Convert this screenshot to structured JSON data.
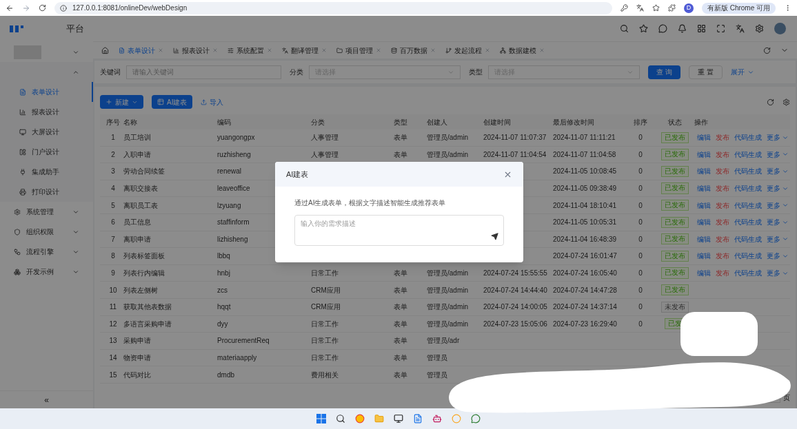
{
  "browser": {
    "url": "127.0.0.1:8081/onlineDev/webDesign",
    "profile": "D",
    "update_label": "有新版 Chrome 可用"
  },
  "header": {
    "title": "平台"
  },
  "tabs": [
    {
      "label": "表单设计",
      "selected": true
    },
    {
      "label": "报表设计",
      "selected": false
    },
    {
      "label": "系统配置",
      "selected": false
    },
    {
      "label": "翻译管理",
      "selected": false
    },
    {
      "label": "项目管理",
      "selected": false
    },
    {
      "label": "百万数据",
      "selected": false
    },
    {
      "label": "发起流程",
      "selected": false
    },
    {
      "label": "数据建模",
      "selected": false
    }
  ],
  "sidebar": {
    "menu": [
      {
        "expanded": true,
        "children": [
          {
            "label": "表单设计",
            "selected": true
          },
          {
            "label": "报表设计",
            "selected": false
          },
          {
            "label": "大屏设计",
            "selected": false
          },
          {
            "label": "门户设计",
            "selected": false
          },
          {
            "label": "集成助手",
            "selected": false
          },
          {
            "label": "打印设计",
            "selected": false
          }
        ]
      },
      {
        "label": "系统管理",
        "expanded": false
      },
      {
        "label": "组织权限",
        "expanded": false
      },
      {
        "label": "流程引擎",
        "expanded": false
      },
      {
        "label": "开发示例",
        "expanded": false
      }
    ],
    "collapse": "«"
  },
  "filters": [
    {
      "label": "关键词",
      "kind": "input",
      "placeholder": "请输入关键词"
    },
    {
      "label": "分类",
      "kind": "select",
      "placeholder": "请选择"
    },
    {
      "label": "类型",
      "kind": "select",
      "placeholder": "请选择"
    }
  ],
  "filter_buttons": {
    "query": "查 询",
    "reset": "重 置",
    "expand": "展开"
  },
  "toolbar": {
    "new": "新建",
    "ai": "AI建表",
    "import": "导入"
  },
  "table": {
    "columns": [
      "序号",
      "名称",
      "编码",
      "分类",
      "类型",
      "创建人",
      "创建时间",
      "最后修改时间",
      "排序",
      "状态",
      "操作"
    ],
    "rows": [
      {
        "index": "1",
        "name": "员工培训",
        "code": "yuangongpx",
        "category": "人事管理",
        "type": "表单",
        "creator": "管理员/admin",
        "created": "2024-11-07 11:07:37",
        "modified": "2024-11-07 11:11:21",
        "sort": "0",
        "status": {
          "label": "已发布",
          "published": true
        },
        "actions": [
          {
            "label": "编辑",
            "kind": "link"
          },
          {
            "label": "发布",
            "kind": "danger"
          },
          {
            "label": "代码生成",
            "kind": "link"
          },
          {
            "label": "更多",
            "kind": "dropdown"
          }
        ]
      },
      {
        "index": "2",
        "name": "入职申请",
        "code": "ruzhisheng",
        "category": "人事管理",
        "type": "表单",
        "creator": "管理员/admin",
        "created": "2024-11-07 11:04:54",
        "modified": "2024-11-07 11:04:58",
        "sort": "0",
        "status": {
          "label": "已发布",
          "published": true
        },
        "actions": [
          {
            "label": "编辑",
            "kind": "link"
          },
          {
            "label": "发布",
            "kind": "danger"
          },
          {
            "label": "代码生成",
            "kind": "link"
          },
          {
            "label": "更多",
            "kind": "dropdown"
          }
        ]
      },
      {
        "index": "3",
        "name": "劳动合同续签",
        "code": "renewal",
        "modified": "2024-11-05 10:08:45",
        "sort": "0",
        "status": {
          "label": "已发布",
          "published": true
        },
        "actions": [
          {
            "label": "编辑",
            "kind": "link"
          },
          {
            "label": "发布",
            "kind": "danger"
          },
          {
            "label": "代码生成",
            "kind": "link"
          },
          {
            "label": "更多",
            "kind": "dropdown"
          }
        ]
      },
      {
        "index": "4",
        "name": "离职交接表",
        "code": "leaveoffice",
        "modified": "2024-11-05 09:38:49",
        "sort": "0",
        "status": {
          "label": "已发布",
          "published": true
        },
        "actions": [
          {
            "label": "编辑",
            "kind": "link"
          },
          {
            "label": "发布",
            "kind": "danger"
          },
          {
            "label": "代码生成",
            "kind": "link"
          },
          {
            "label": "更多",
            "kind": "dropdown"
          }
        ]
      },
      {
        "index": "5",
        "name": "离职员工表",
        "code": "lzyuang",
        "modified": "2024-11-04 18:10:41",
        "sort": "0",
        "status": {
          "label": "已发布",
          "published": true
        },
        "actions": [
          {
            "label": "编辑",
            "kind": "link"
          },
          {
            "label": "发布",
            "kind": "danger"
          },
          {
            "label": "代码生成",
            "kind": "link"
          },
          {
            "label": "更多",
            "kind": "dropdown"
          }
        ]
      },
      {
        "index": "6",
        "name": "员工信息",
        "code": "staffinform",
        "modified": "2024-11-05 10:05:31",
        "sort": "0",
        "status": {
          "label": "已发布",
          "published": true
        },
        "actions": [
          {
            "label": "编辑",
            "kind": "link"
          },
          {
            "label": "发布",
            "kind": "danger"
          },
          {
            "label": "代码生成",
            "kind": "link"
          },
          {
            "label": "更多",
            "kind": "dropdown"
          }
        ]
      },
      {
        "index": "7",
        "name": "离职申请",
        "code": "lizhisheng",
        "modified": "2024-11-04 16:48:39",
        "sort": "0",
        "status": {
          "label": "已发布",
          "published": true
        },
        "actions": [
          {
            "label": "编辑",
            "kind": "link"
          },
          {
            "label": "发布",
            "kind": "danger"
          },
          {
            "label": "代码生成",
            "kind": "link"
          },
          {
            "label": "更多",
            "kind": "dropdown"
          }
        ]
      },
      {
        "index": "8",
        "name": "列表标签面板",
        "code": "lbbq",
        "modified": "2024-07-24 16:01:47",
        "sort": "0",
        "status": {
          "label": "已发布",
          "published": true
        },
        "actions": [
          {
            "label": "编辑",
            "kind": "link"
          },
          {
            "label": "发布",
            "kind": "danger"
          },
          {
            "label": "代码生成",
            "kind": "link"
          },
          {
            "label": "更多",
            "kind": "dropdown"
          }
        ]
      },
      {
        "index": "9",
        "name": "列表行内编辑",
        "code": "hnbj",
        "category": "日常工作",
        "type": "表单",
        "creator": "管理员/admin",
        "created": "2024-07-24 15:55:55",
        "modified": "2024-07-24 16:05:40",
        "sort": "0",
        "status": {
          "label": "已发布",
          "published": true
        },
        "actions": [
          {
            "label": "编辑",
            "kind": "link"
          },
          {
            "label": "发布",
            "kind": "danger"
          },
          {
            "label": "代码生成",
            "kind": "link"
          },
          {
            "label": "更多",
            "kind": "dropdown"
          }
        ]
      },
      {
        "index": "10",
        "name": "列表左侧树",
        "code": "zcs",
        "category": "CRM应用",
        "type": "表单",
        "creator": "管理员/admin",
        "created": "2024-07-24 14:44:40",
        "modified": "2024-07-24 14:47:28",
        "sort": "0",
        "status": {
          "label": "已发布",
          "published": true
        }
      },
      {
        "index": "11",
        "name": "获取其他表数据",
        "code": "hqqt",
        "category": "CRM应用",
        "type": "表单",
        "creator": "管理员/admin",
        "created": "2024-07-24 14:00:05",
        "modified": "2024-07-24 14:37:14",
        "sort": "0",
        "status": {
          "label": "未发布",
          "published": false
        }
      },
      {
        "index": "12",
        "name": "多语言采购申请",
        "code": "dyy",
        "category": "日常工作",
        "type": "表单",
        "creator": "管理员/admin",
        "created": "2024-07-23 15:05:06",
        "modified": "2024-07-23 16:29:40",
        "sort": "0",
        "status": {
          "label": "已发",
          "published": true
        }
      },
      {
        "index": "13",
        "name": "采购申请",
        "code": "ProcurementReq",
        "category": "日常工作",
        "type": "表单",
        "creator": "管理员/adr"
      },
      {
        "index": "14",
        "name": "物资申请",
        "code": "materiaapply",
        "category": "日常工作",
        "type": "表单",
        "creator": "管理员"
      },
      {
        "index": "15",
        "name": "代码对比",
        "code": "dmdb",
        "category": "费用相关",
        "type": "表单",
        "creator": "管理员"
      }
    ]
  },
  "pagination": {
    "suffix": "页"
  },
  "dialog": {
    "title": "AI建表",
    "description": "通过AI生成表单，根据文字描述智能生成推荐表单",
    "placeholder": "输入你的需求描述"
  }
}
